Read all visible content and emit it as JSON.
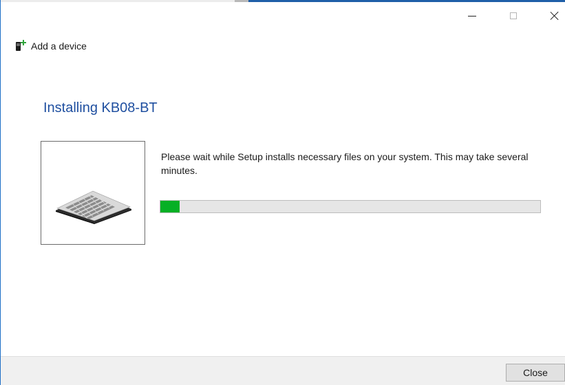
{
  "window": {
    "controls": {
      "minimize": "minimize",
      "maximize": "maximize",
      "close": "close"
    }
  },
  "header": {
    "title": "Add a device",
    "icon": "add-device-icon"
  },
  "main": {
    "title": "Installing KB08-BT",
    "device_image": "keyboard",
    "message": "Please wait while Setup installs necessary files on your system. This may take several minutes.",
    "progress": {
      "percent": 5,
      "color": "#06b025"
    }
  },
  "footer": {
    "close_label": "Close"
  },
  "colors": {
    "title": "#1f4fa0",
    "progress_fill": "#06b025",
    "footer_bg": "#f0f0f0"
  }
}
